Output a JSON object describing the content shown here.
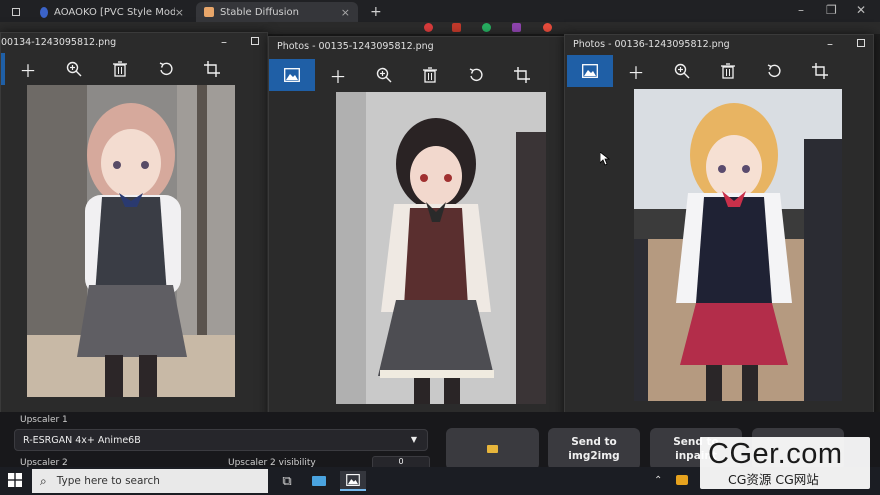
{
  "browser": {
    "tabs": [
      {
        "label": "AOAOKO [PVC Style Model] - PVC",
        "icon": "civitai-icon"
      },
      {
        "label": "Stable Diffusion",
        "icon": "sd-icon"
      }
    ],
    "new_tab": "+"
  },
  "photos_windows": [
    {
      "title": "00134-1243095812.png"
    },
    {
      "title": "Photos - 00135-1243095812.png"
    },
    {
      "title": "Photos - 00136-1243095812.png"
    }
  ],
  "toolbar_icons": [
    "image-icon",
    "add-icon",
    "zoom-in-icon",
    "delete-icon",
    "rotate-icon",
    "crop-icon"
  ],
  "sd": {
    "upscaler1_label": "Upscaler 1",
    "upscaler1_value": "R-ESRGAN 4x+ Anime6B",
    "upscaler2_label": "Upscaler 2",
    "upscaler2_vis_label": "Upscaler 2 visibility",
    "upscaler2_vis_value": "0",
    "send_img2img": "Send to img2img",
    "send_inpaint": "Send to inpaint"
  },
  "taskbar": {
    "search_placeholder": "Type here to search"
  },
  "watermark": {
    "big": "CGer.com",
    "small": "CG资源 CG网站"
  },
  "colors": {
    "accent": "#1f5fa6",
    "window_bg": "#2b2b2b",
    "taskbar_bg": "#1b1d23"
  }
}
